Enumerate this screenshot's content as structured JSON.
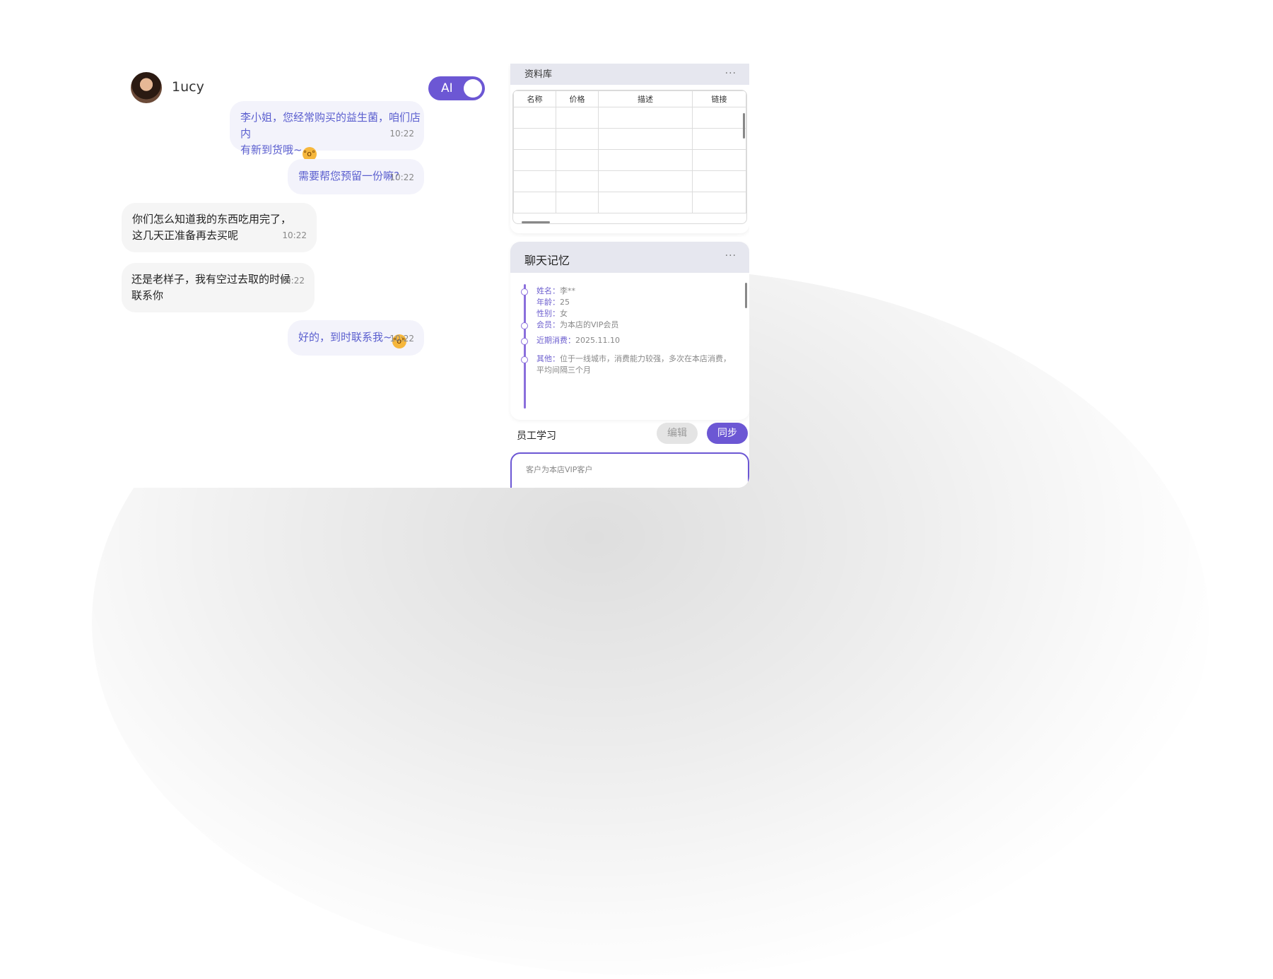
{
  "chat": {
    "username": "1ucy",
    "ai_toggle": {
      "label": "AI",
      "on": true
    },
    "messages": [
      {
        "side": "me",
        "line1": "李小姐，您经常购买的益生菌，咱们店内",
        "line2": "有新到货哦~",
        "time": "10:22"
      },
      {
        "side": "me",
        "line1": "需要帮您预留一份嘛?",
        "time": "10:22"
      },
      {
        "side": "them",
        "line1": "你们怎么知道我的东西吃用完了，",
        "line2": "这几天正准备再去买呢",
        "time": "10:22"
      },
      {
        "side": "them",
        "line1": "还是老样子，我有空过去取的时候",
        "line2": "联系你",
        "time": "10:22"
      },
      {
        "side": "me",
        "line1": "好的，到时联系我~",
        "time": "10:22"
      }
    ]
  },
  "library": {
    "title": "资料库",
    "more": "···",
    "columns": [
      "名称",
      "价格",
      "描述",
      "链接"
    ]
  },
  "memory": {
    "title": "聊天记忆",
    "more": "···",
    "items": [
      {
        "key": "姓名：",
        "value": "李**"
      },
      {
        "key": "年龄：",
        "value": "25"
      },
      {
        "key": "性别：",
        "value": "女"
      },
      {
        "key": "会员：",
        "value": "为本店的VIP会员"
      },
      {
        "key": "近期消费：",
        "value": "2025.11.10"
      },
      {
        "key": "其他：",
        "value": "位于一线城市，消费能力较强，多次在本店消费，平均间隔三个月"
      }
    ]
  },
  "learning": {
    "title": "员工学习",
    "edit_label": "编辑",
    "sync_label": "同步",
    "input_value": "客户为本店VIP客户"
  },
  "colors": {
    "accent": "#6c57d4",
    "me_text": "#5b5fcf",
    "me_bg": "#f3f3fb",
    "them_bg": "#f5f5f5"
  }
}
